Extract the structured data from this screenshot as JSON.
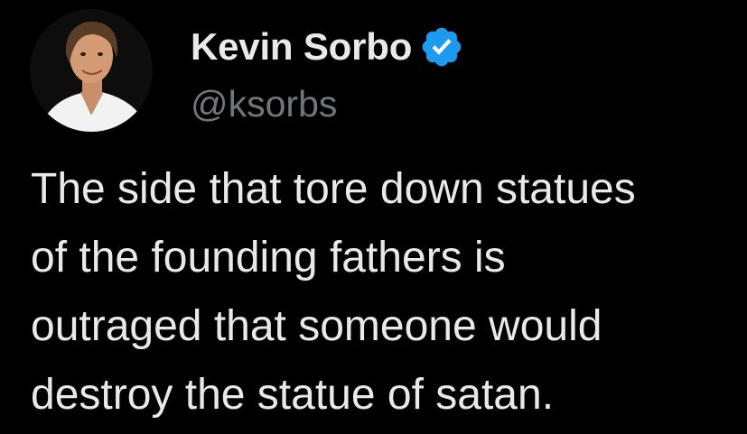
{
  "author": {
    "display_name": "Kevin Sorbo",
    "handle": "@ksorbs",
    "verified_badge_icon": "verified-checkmark-icon",
    "avatar_icon": "profile-photo"
  },
  "tweet": {
    "text_lines": [
      "The side that tore down statues",
      "of the founding fathers is",
      "outraged that someone would",
      "destroy the statue of satan."
    ]
  },
  "colors": {
    "background": "#000000",
    "text_primary": "#e7e9ea",
    "text_secondary": "#71767b",
    "verified_blue": "#1d9bf0"
  }
}
